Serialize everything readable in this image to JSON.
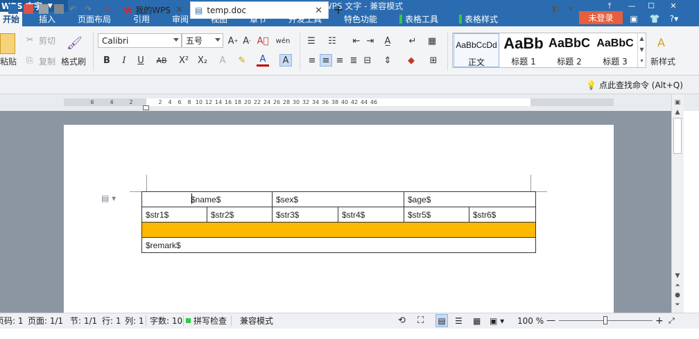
{
  "titlebar": {
    "app_name": "WPS 文字",
    "doc_title": "temp.doc - WPS 文字 - 兼容模式",
    "doc_icon": "W"
  },
  "menu": {
    "tabs": [
      "开始",
      "插入",
      "页面布局",
      "引用",
      "审阅",
      "视图",
      "章节",
      "开发工具",
      "特色功能",
      "表格工具",
      "表格样式"
    ],
    "login": "未登录"
  },
  "ribbon": {
    "paste": "粘贴",
    "cut": "剪切",
    "copy": "复制",
    "format_painter": "格式刷",
    "font_name": "Calibri",
    "font_size": "五号",
    "styles": [
      {
        "sample": "AaBbCcDd",
        "name": "正文"
      },
      {
        "sample": "AaBb",
        "name": "标题 1"
      },
      {
        "sample": "AaBbC",
        "name": "标题 2"
      },
      {
        "sample": "AaBbC",
        "name": "标题 3"
      }
    ],
    "new_style": "新样式"
  },
  "doc_tabs": {
    "wps_tab": "我的WPS",
    "doc_tab": "temp.doc",
    "help_search": "点此查找命令 (Alt+Q)"
  },
  "ruler": {
    "left_numbers": [
      "6",
      "4",
      "2"
    ],
    "right_numbers": [
      "2",
      "4",
      "6",
      "8",
      "10",
      "12",
      "14",
      "16",
      "18",
      "20",
      "22",
      "24",
      "26",
      "28",
      "30",
      "32",
      "34",
      "36",
      "38",
      "40",
      "42",
      "44",
      "46"
    ]
  },
  "document": {
    "row1": [
      "$name$",
      "$sex$",
      "$age$"
    ],
    "row2": [
      "$str1$",
      "$str2$",
      "$str3$",
      "$str4$",
      "$str5$",
      "$str6$"
    ],
    "row4": [
      "$remark$"
    ],
    "highlight_color": "#fdb801"
  },
  "status": {
    "page_code": "页码: 1",
    "page": "页面: 1/1",
    "section": "节: 1/1",
    "row": "行: 1",
    "col": "列: 1",
    "words": "字数: 10",
    "spell": "拼写检查",
    "compat": "兼容模式",
    "zoom": "100 %"
  }
}
